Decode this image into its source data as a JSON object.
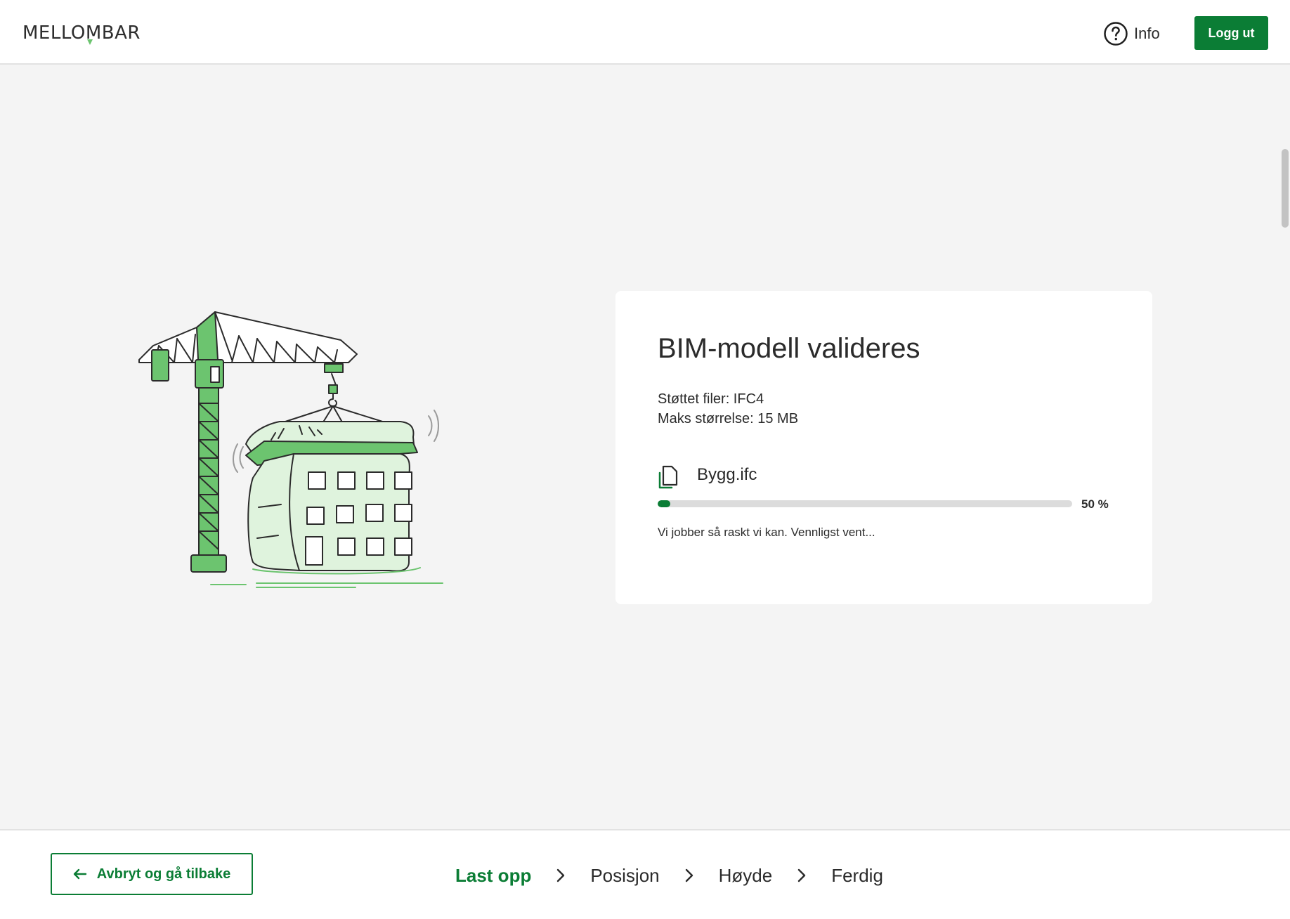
{
  "header": {
    "logo_text": "MELLOMBAR",
    "info_label": "Info",
    "logout_label": "Logg ut"
  },
  "card": {
    "title": "BIM-modell valideres",
    "supported_files": "Støttet filer: IFC4",
    "max_size": "Maks størrelse: 15 MB",
    "file_name": "Bygg.ifc",
    "progress_value": 0.5,
    "progress_label": "50 %",
    "hint": "Vi jobber så raskt vi kan. Vennligst vent..."
  },
  "footer": {
    "back_label": "Avbryt og gå tilbake",
    "steps": [
      {
        "label": "Last opp",
        "active": true
      },
      {
        "label": "Posisjon",
        "active": false
      },
      {
        "label": "Høyde",
        "active": false
      },
      {
        "label": "Ferdig",
        "active": false
      }
    ]
  },
  "colors": {
    "brand_green": "#0b7d35",
    "illustration_green": "#6cc46f",
    "illustration_light_green": "#dff3dd"
  },
  "icons": {
    "info": "question-circle-icon",
    "file": "document-icon",
    "back": "arrow-left-icon",
    "step_separator": "chevron-right-icon"
  }
}
